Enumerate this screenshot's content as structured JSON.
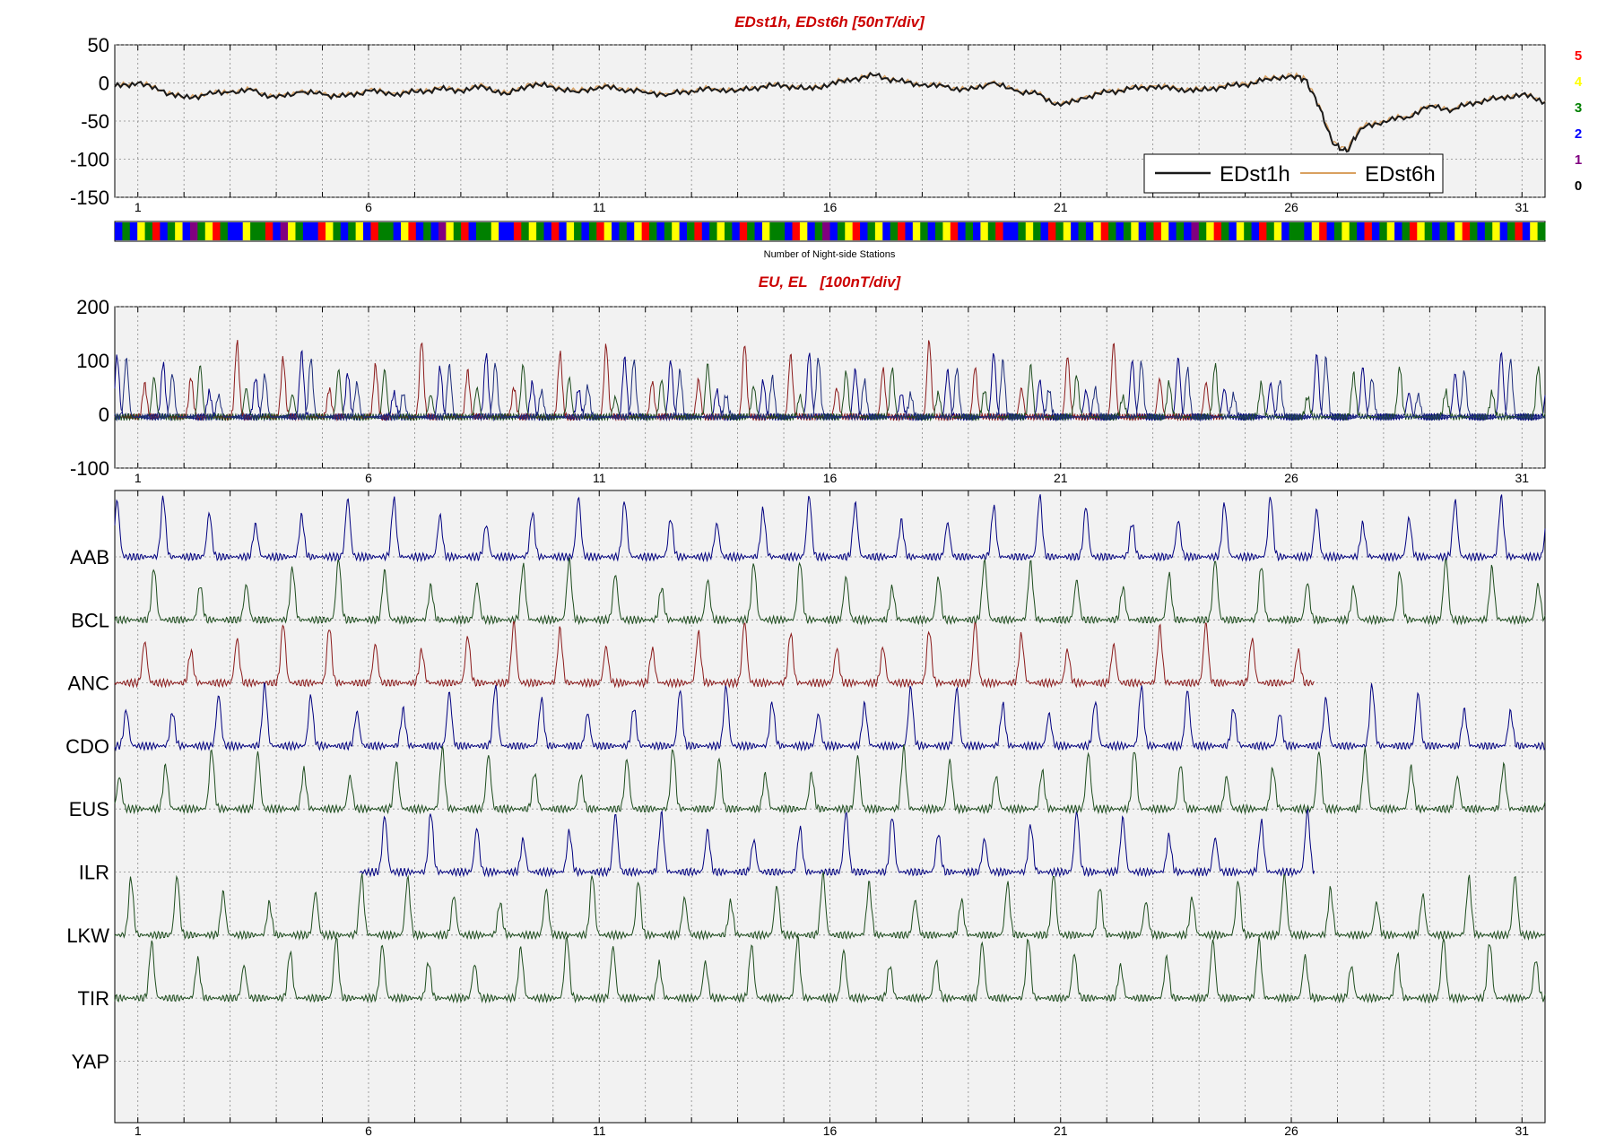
{
  "chart_data": [
    {
      "type": "line",
      "title": "EDst1h, EDst6h [50nT/div]",
      "xlabel": "",
      "ylabel": "",
      "x_ticks": [
        1,
        6,
        11,
        16,
        21,
        26,
        31
      ],
      "x_tick_labels": [
        "1",
        "6",
        "11",
        "16",
        "21",
        "26",
        "31"
      ],
      "xlim": [
        0.5,
        31.5
      ],
      "ylim": [
        -150,
        50
      ],
      "y_ticks": [
        50,
        0,
        -50,
        -100,
        -150
      ],
      "y_tick_labels": [
        "50",
        "0",
        "-50",
        "-100",
        "-150"
      ],
      "grid": true,
      "legend_position": "bottom-right",
      "series": [
        {
          "name": "EDst1h",
          "color": "#1a1a1a",
          "x": [
            0.5,
            1,
            1.5,
            2,
            2.5,
            3,
            3.5,
            4,
            4.5,
            5,
            5.5,
            6,
            6.5,
            7,
            7.5,
            8,
            8.5,
            9,
            9.5,
            10,
            10.5,
            11,
            11.5,
            12,
            12.5,
            13,
            13.5,
            14,
            14.5,
            15,
            15.5,
            16,
            16.5,
            17,
            17.5,
            18,
            18.5,
            19,
            19.5,
            20,
            20.5,
            21,
            21.5,
            22,
            22.5,
            23,
            23.5,
            24,
            24.5,
            25,
            25.5,
            26,
            26.3,
            26.6,
            26.9,
            27.2,
            27.5,
            28,
            28.5,
            29,
            29.5,
            30,
            30.5,
            31,
            31.5
          ],
          "y": [
            -5,
            0,
            -10,
            -20,
            -15,
            -12,
            -10,
            -20,
            -12,
            -15,
            -18,
            -10,
            -15,
            -12,
            -8,
            -10,
            -5,
            -15,
            -2,
            -5,
            -12,
            -5,
            -8,
            -12,
            -15,
            -10,
            -8,
            -10,
            -5,
            -3,
            -8,
            -2,
            5,
            10,
            2,
            -3,
            -5,
            -10,
            0,
            -10,
            -15,
            -30,
            -20,
            -12,
            -8,
            -5,
            -8,
            -10,
            -5,
            -2,
            5,
            10,
            5,
            -30,
            -80,
            -90,
            -60,
            -50,
            -45,
            -30,
            -35,
            -25,
            -20,
            -15,
            -25
          ]
        },
        {
          "name": "EDst6h",
          "color": "#d9a060",
          "x": [
            0.5,
            1,
            1.5,
            2,
            2.5,
            3,
            3.5,
            4,
            4.5,
            5,
            5.5,
            6,
            6.5,
            7,
            7.5,
            8,
            8.5,
            9,
            9.5,
            10,
            10.5,
            11,
            11.5,
            12,
            12.5,
            13,
            13.5,
            14,
            14.5,
            15,
            15.5,
            16,
            16.5,
            17,
            17.5,
            18,
            18.5,
            19,
            19.5,
            20,
            20.5,
            21,
            21.5,
            22,
            22.5,
            23,
            23.5,
            24,
            24.5,
            25,
            25.5,
            26,
            26.3,
            26.6,
            26.9,
            27.2,
            27.5,
            28,
            28.5,
            29,
            29.5,
            30,
            30.5,
            31,
            31.5
          ],
          "y": [
            -4,
            1,
            -9,
            -19,
            -14,
            -11,
            -9,
            -19,
            -11,
            -14,
            -17,
            -9,
            -14,
            -11,
            -7,
            -9,
            -4,
            -14,
            -1,
            -4,
            -11,
            -4,
            -7,
            -11,
            -14,
            -9,
            -7,
            -9,
            -4,
            -2,
            -7,
            -1,
            6,
            11,
            3,
            -2,
            -4,
            -9,
            1,
            -9,
            -14,
            -29,
            -19,
            -11,
            -7,
            -4,
            -7,
            -9,
            -4,
            -1,
            6,
            11,
            6,
            -28,
            -78,
            -88,
            -58,
            -49,
            -44,
            -29,
            -34,
            -24,
            -19,
            -14,
            -24
          ]
        }
      ],
      "legend": [
        "EDst1h",
        "EDst6h"
      ]
    },
    {
      "type": "heatmap",
      "xlabel": "Number of Night-side Stations",
      "color_scale": [
        {
          "label": "5",
          "color": "#ff0000"
        },
        {
          "label": "4",
          "color": "#ffff00"
        },
        {
          "label": "3",
          "color": "#008000"
        },
        {
          "label": "2",
          "color": "#0000ff"
        },
        {
          "label": "1",
          "color": "#800080"
        },
        {
          "label": "0",
          "color": "#000000"
        }
      ],
      "xlim": [
        0.5,
        31.5
      ],
      "values": [
        2,
        3,
        2,
        4,
        3,
        5,
        2,
        3,
        4,
        2,
        1,
        3,
        4,
        5,
        3,
        2,
        2,
        4,
        3,
        3,
        5,
        2,
        1,
        4,
        3,
        2,
        2,
        5,
        4,
        3,
        2,
        3,
        4,
        2,
        5,
        3,
        3,
        2,
        4,
        5,
        2,
        3,
        2,
        1,
        4,
        3,
        5,
        2,
        3,
        3,
        4,
        2,
        2,
        5,
        3,
        4,
        3,
        2,
        5,
        2,
        4,
        3,
        2,
        3,
        5,
        4,
        2,
        3,
        2,
        4,
        5,
        3,
        2,
        3,
        4,
        2,
        3,
        5,
        2,
        3,
        4,
        3,
        2,
        5,
        3,
        2,
        4,
        3,
        3,
        2,
        5,
        4,
        2,
        3,
        1,
        2,
        3,
        4,
        5,
        2,
        3,
        4,
        2,
        3,
        5,
        2,
        4,
        3,
        2,
        3,
        4,
        5,
        2,
        3,
        2,
        4,
        3,
        5,
        2,
        2,
        3,
        4,
        3,
        2,
        5,
        3,
        4,
        2,
        3,
        2,
        4,
        5,
        3,
        2,
        3,
        4,
        2,
        3,
        5,
        4,
        2,
        3,
        2,
        1,
        3,
        4,
        5,
        3,
        2,
        4,
        3,
        2,
        5,
        3,
        4,
        2,
        3,
        3,
        2,
        4,
        5,
        2,
        3,
        4,
        3,
        2,
        5,
        2,
        3,
        4,
        2,
        3,
        5,
        4,
        3,
        2,
        3,
        2,
        4,
        5,
        3,
        2,
        3,
        4,
        2,
        3,
        5,
        2,
        4,
        3
      ]
    },
    {
      "type": "line",
      "title": "EU, EL   [100nT/div]",
      "xlabel": "",
      "ylabel": "",
      "x_ticks": [
        1,
        6,
        11,
        16,
        21,
        26,
        31
      ],
      "x_tick_labels": [
        "1",
        "6",
        "11",
        "16",
        "21",
        "26",
        "31"
      ],
      "xlim": [
        0.5,
        31.5
      ],
      "ylim": [
        -100,
        200
      ],
      "y_ticks": [
        200,
        100,
        0,
        -100
      ],
      "y_tick_labels": [
        "200",
        "100",
        "0",
        "-100"
      ],
      "grid": true,
      "series": [
        {
          "color": "#000080",
          "daily_peak": 110,
          "peak_phase": 0.55,
          "days": [
            1,
            31
          ]
        },
        {
          "color": "#8b1a1a",
          "daily_peak": 130,
          "peak_phase": 0.15,
          "days": [
            1,
            24
          ]
        },
        {
          "color": "#1e4d1e",
          "daily_peak": 90,
          "peak_phase": 0.35,
          "days": [
            1,
            31
          ]
        },
        {
          "color": "#1c2c7a",
          "daily_peak": 100,
          "peak_phase": 0.75,
          "days": [
            1,
            31
          ]
        }
      ]
    },
    {
      "type": "line",
      "title": "",
      "xlabel": "",
      "ylabel": "",
      "x_ticks": [
        1,
        6,
        11,
        16,
        21,
        26,
        31
      ],
      "x_tick_labels": [
        "1",
        "6",
        "11",
        "16",
        "21",
        "26",
        "31"
      ],
      "xlim": [
        0.5,
        31.5
      ],
      "grid": true,
      "stations": [
        {
          "name": "AAB",
          "color": "#000080",
          "peak_phase": 0.55,
          "days": [
            1,
            31
          ]
        },
        {
          "name": "BCL",
          "color": "#1e4d1e",
          "peak_phase": 0.35,
          "days": [
            1,
            31
          ]
        },
        {
          "name": "ANC",
          "color": "#8b1a1a",
          "peak_phase": 0.15,
          "days": [
            1,
            26
          ]
        },
        {
          "name": "CDO",
          "color": "#000080",
          "peak_phase": 0.75,
          "days": [
            1,
            31
          ]
        },
        {
          "name": "EUS",
          "color": "#1e4d1e",
          "peak_phase": 0.6,
          "days": [
            1,
            31
          ]
        },
        {
          "name": "ILR",
          "color": "#000080",
          "peak_phase": 0.35,
          "days": [
            6.3,
            26
          ]
        },
        {
          "name": "LKW",
          "color": "#1e4d1e",
          "peak_phase": 0.85,
          "days": [
            1,
            31
          ]
        },
        {
          "name": "TIR",
          "color": "#1e4d1e",
          "peak_phase": 0.3,
          "days": [
            1,
            31
          ]
        },
        {
          "name": "YAP",
          "color": "#1e4d1e",
          "peak_phase": 0.5,
          "days": []
        }
      ]
    }
  ]
}
